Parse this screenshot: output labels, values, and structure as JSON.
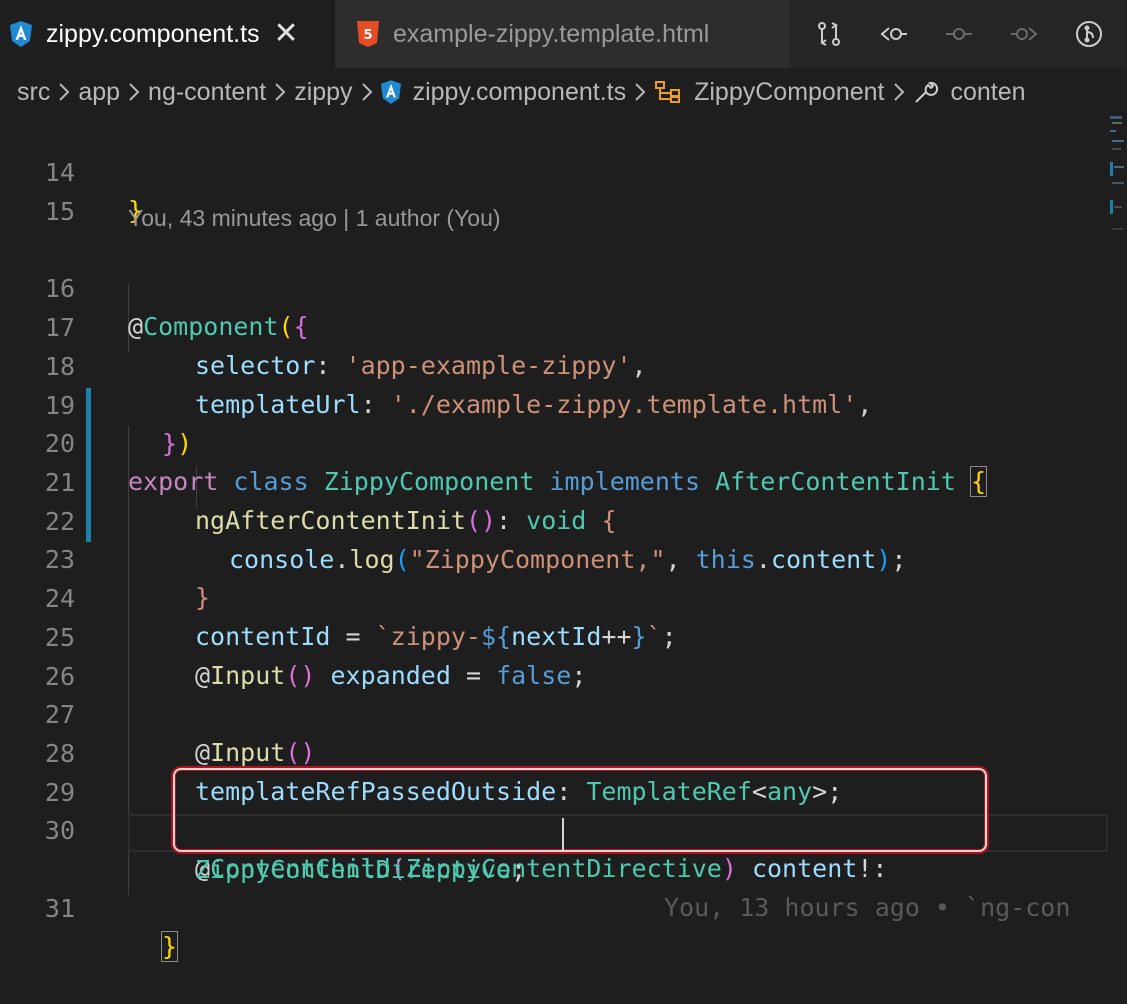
{
  "tabs": [
    {
      "label": "zippy.component.ts",
      "icon": "angular-icon",
      "active": true,
      "close": "✕"
    },
    {
      "label": "example-zippy.template.html",
      "icon": "html5-icon",
      "active": false
    }
  ],
  "breadcrumb": [
    "src",
    "app",
    "ng-content",
    "zippy",
    "zippy.component.ts",
    "ZippyComponent",
    "conten"
  ],
  "codelens": "You, 43 minutes ago | 1 author (You)",
  "line_numbers": [
    "14",
    "15",
    "16",
    "17",
    "18",
    "19",
    "20",
    "21",
    "22",
    "23",
    "24",
    "25",
    "26",
    "27",
    "28",
    "29",
    "30",
    "31"
  ],
  "code": {
    "l14": {
      "close": "}"
    },
    "l16": {
      "at": "@",
      "name": "Component",
      "open": "(",
      "brace": "{"
    },
    "l17": {
      "key": "selector",
      "colon": ": ",
      "value": "'app-example-zippy'",
      "comma": ","
    },
    "l18": {
      "key": "templateUrl",
      "colon": ": ",
      "value": "'./example-zippy.template.html'",
      "comma": ","
    },
    "l19": {
      "brace": "}",
      "paren": ")"
    },
    "l20": {
      "export": "export",
      "class": "class",
      "name": "ZippyComponent",
      "implements": "implements",
      "iface": "AfterContentInit",
      "brace": "{"
    },
    "l21": {
      "method": "ngAfterContentInit",
      "parens": "()",
      "colon": ": ",
      "type": "void",
      "brace": "{"
    },
    "l22": {
      "obj": "console",
      "dot": ".",
      "fn": "log",
      "open": "(",
      "str": "\"ZippyComponent,\"",
      "comma": ", ",
      "this": "this",
      "dot2": ".",
      "prop": "content",
      "close": ")",
      "semi": ";"
    },
    "l23": {
      "brace": "}"
    },
    "l24": {
      "prop": "contentId",
      "eq": " = ",
      "tpl_start": "`zippy-",
      "interp_open": "${",
      "var": "nextId",
      "op": "++",
      "interp_close": "}",
      "tpl_end": "`",
      "semi": ";"
    },
    "l25": {
      "at": "@",
      "dec": "Input",
      "parens": "()",
      "prop": "expanded",
      "eq": " = ",
      "val": "false",
      "semi": ";"
    },
    "l27": {
      "at": "@",
      "dec": "Input",
      "parens": "()"
    },
    "l28": {
      "prop": "templateRefPassedOutside",
      "colon": ": ",
      "type": "TemplateRef",
      "lt": "<",
      "any": "any",
      "gt": ">",
      "semi": ";"
    },
    "l30": {
      "at": "@",
      "dec": "ContentChild",
      "open": "(",
      "arg": "ZippyContentDirective",
      "close": ")",
      "prop": "content",
      "bang": "!:"
    },
    "l30b": {
      "type": "ZippyContentDirective",
      "semi": ";",
      "ghost": "You, 13 hours ago • `ng-con"
    },
    "l31": {
      "brace": "}"
    }
  }
}
